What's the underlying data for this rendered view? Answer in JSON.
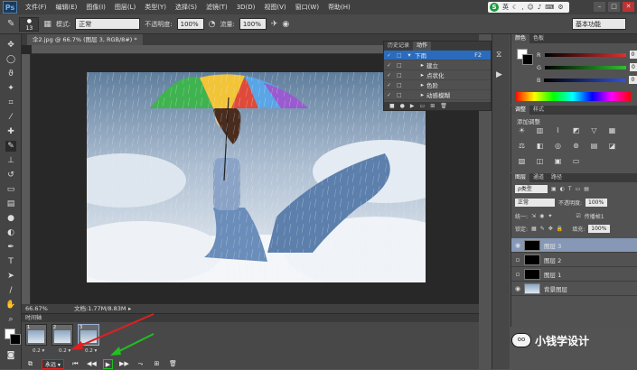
{
  "menubar": {
    "logo": "Ps",
    "items": [
      "文件(F)",
      "编辑(E)",
      "图像(I)",
      "图层(L)",
      "类型(Y)",
      "选择(S)",
      "滤镜(T)",
      "3D(D)",
      "视图(V)",
      "窗口(W)",
      "帮助(H)"
    ],
    "ime_label": "英"
  },
  "options": {
    "brush_size": "13",
    "mode_label": "模式:",
    "mode_value": "正常",
    "opacity_label": "不透明度:",
    "opacity_value": "100%",
    "flow_label": "流量:",
    "flow_value": "100%",
    "workspace": "基本功能"
  },
  "document": {
    "tab_title": "伞2.jpg @ 66.7% (图层 3, RGB/8#) *",
    "zoom": "66.67%",
    "doc_size": "文档:1.77M/8.83M"
  },
  "actions_panel": {
    "tabs": [
      "历史记录",
      "动作"
    ],
    "rows": [
      {
        "label": "下雨",
        "shortcut": "F2"
      },
      {
        "label": "建立",
        "shortcut": ""
      },
      {
        "label": "点状化",
        "shortcut": ""
      },
      {
        "label": "色阶",
        "shortcut": ""
      },
      {
        "label": "动感模糊",
        "shortcut": ""
      }
    ]
  },
  "color_panel": {
    "tabs": [
      "颜色",
      "色板"
    ],
    "channels": [
      {
        "label": "R",
        "value": "0",
        "color": "#e03030"
      },
      {
        "label": "G",
        "value": "0",
        "color": "#30c030"
      },
      {
        "label": "B",
        "value": "0",
        "color": "#3050e0"
      }
    ]
  },
  "adjust_panel": {
    "tabs": [
      "调整",
      "样式"
    ],
    "title": "添加调整"
  },
  "layers_panel": {
    "tabs": [
      "图层",
      "通道",
      "路径"
    ],
    "kind_label": "ρ类型",
    "blend_mode": "正常",
    "opacity_label": "不透明度:",
    "opacity_value": "100%",
    "lock_label": "统一:",
    "propagate_label": "传播帧1",
    "lock2_label": "锁定:",
    "fill_label": "填充:",
    "fill_value": "100%",
    "layers": [
      {
        "name": "图层 3",
        "selected": true
      },
      {
        "name": "图层 2",
        "selected": false
      },
      {
        "name": "图层 1",
        "selected": false
      },
      {
        "name": "背景图层",
        "selected": false
      }
    ]
  },
  "timeline": {
    "title": "时间轴",
    "frames": [
      {
        "num": "1",
        "delay": "0.2 ▾"
      },
      {
        "num": "2",
        "delay": "0.2 ▾"
      },
      {
        "num": "3",
        "delay": "0.2 ▾"
      }
    ],
    "loop": "永远"
  },
  "watermark": {
    "logo_text": "oo",
    "text": "小钱学设计"
  }
}
